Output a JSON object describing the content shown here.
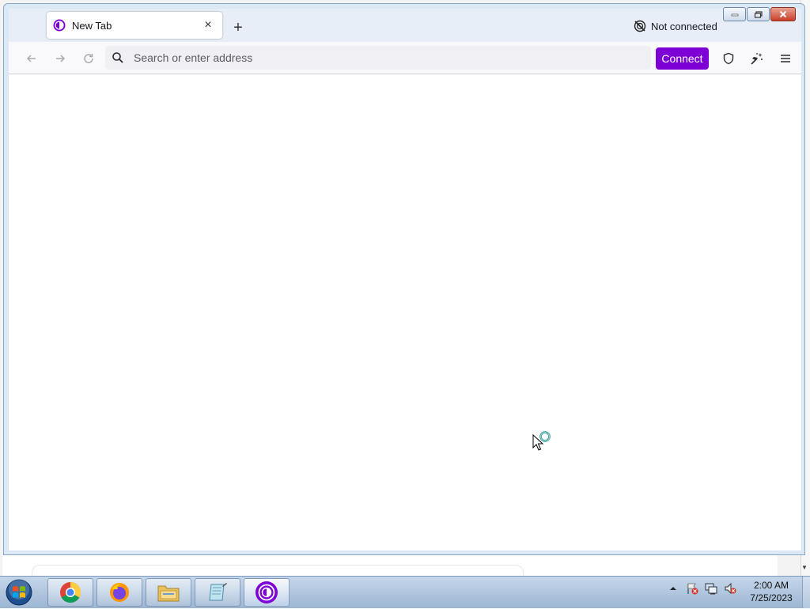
{
  "browser": {
    "tab": {
      "title": "New Tab",
      "close": "×"
    },
    "new_tab": "+",
    "connection_status": "Not connected",
    "address_bar": {
      "value": "",
      "placeholder": "Search or enter address"
    },
    "connect_label": "Connect",
    "colors": {
      "accent": "#7d00d5",
      "tab_bar": "#e7eef7",
      "toolbar": "#f9f9fb",
      "urlbar": "#f0f0f4"
    },
    "icons": [
      "tor-browser-icon",
      "back-icon",
      "forward-icon",
      "reload-icon",
      "search-icon",
      "shield-icon",
      "new-identity-icon",
      "hamburger-menu-icon",
      "not-connected-icon"
    ]
  },
  "taskbar": {
    "apps": [
      "chrome-icon",
      "firefox-icon",
      "file-explorer-icon",
      "notepad-icon",
      "tor-browser-icon"
    ],
    "tray_icons": [
      "show-hidden-icons-icon",
      "action-center-icon",
      "network-icon",
      "volume-muted-icon"
    ],
    "clock": {
      "time": "2:00 AM",
      "date": "7/25/2023"
    }
  }
}
